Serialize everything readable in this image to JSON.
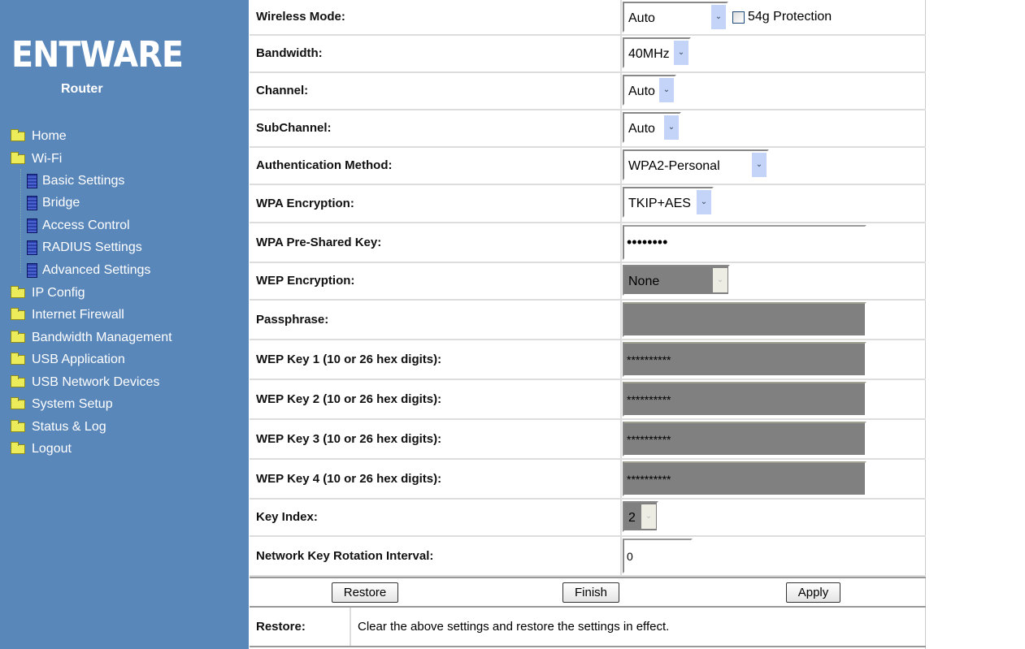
{
  "sidebar": {
    "logo": "ENTWARE",
    "subtitle": "Router",
    "items": [
      {
        "label": "Home",
        "type": "folder"
      },
      {
        "label": "Wi-Fi",
        "type": "folder-open"
      },
      {
        "label": "Basic Settings",
        "type": "doc"
      },
      {
        "label": "Bridge",
        "type": "doc"
      },
      {
        "label": "Access Control",
        "type": "doc"
      },
      {
        "label": "RADIUS Settings",
        "type": "doc"
      },
      {
        "label": "Advanced Settings",
        "type": "doc"
      },
      {
        "label": "IP Config",
        "type": "folder"
      },
      {
        "label": "Internet Firewall",
        "type": "folder"
      },
      {
        "label": "Bandwidth Management",
        "type": "folder"
      },
      {
        "label": "USB Application",
        "type": "folder"
      },
      {
        "label": "USB Network Devices",
        "type": "folder"
      },
      {
        "label": "System Setup",
        "type": "folder"
      },
      {
        "label": "Status & Log",
        "type": "folder"
      },
      {
        "label": "Logout",
        "type": "folder"
      }
    ]
  },
  "form": {
    "rows": [
      {
        "label": "Wireless Mode:",
        "kind": "select",
        "value": "Auto",
        "checkbox_label": "54g Protection",
        "checked": false
      },
      {
        "label": "Bandwidth:",
        "kind": "select",
        "value": "40MHz"
      },
      {
        "label": "Channel:",
        "kind": "select",
        "value": "Auto"
      },
      {
        "label": "SubChannel:",
        "kind": "select",
        "value": "Auto"
      },
      {
        "label": "Authentication Method:",
        "kind": "select",
        "value": "WPA2-Personal"
      },
      {
        "label": "WPA Encryption:",
        "kind": "select",
        "value": "TKIP+AES"
      },
      {
        "label": "WPA Pre-Shared Key:",
        "kind": "password",
        "value": "••••••••"
      },
      {
        "label": "WEP Encryption:",
        "kind": "select",
        "value": "None",
        "disabled": true
      },
      {
        "label": "Passphrase:",
        "kind": "text",
        "value": "",
        "disabled": true
      },
      {
        "label": "WEP Key 1 (10 or 26 hex digits):",
        "kind": "text",
        "value": "**********",
        "disabled": true
      },
      {
        "label": "WEP Key 2 (10 or 26 hex digits):",
        "kind": "text",
        "value": "**********",
        "disabled": true
      },
      {
        "label": "WEP Key 3 (10 or 26 hex digits):",
        "kind": "text",
        "value": "**********",
        "disabled": true
      },
      {
        "label": "WEP Key 4 (10 or 26 hex digits):",
        "kind": "text",
        "value": "**********",
        "disabled": true
      },
      {
        "label": "Key Index:",
        "kind": "select",
        "value": "2",
        "disabled": true
      },
      {
        "label": "Network Key Rotation Interval:",
        "kind": "text",
        "value": "0"
      }
    ]
  },
  "buttons": {
    "restore": "Restore",
    "finish": "Finish",
    "apply": "Apply"
  },
  "help": {
    "term": "Restore:",
    "text": "Clear the above settings and restore the settings in effect."
  }
}
